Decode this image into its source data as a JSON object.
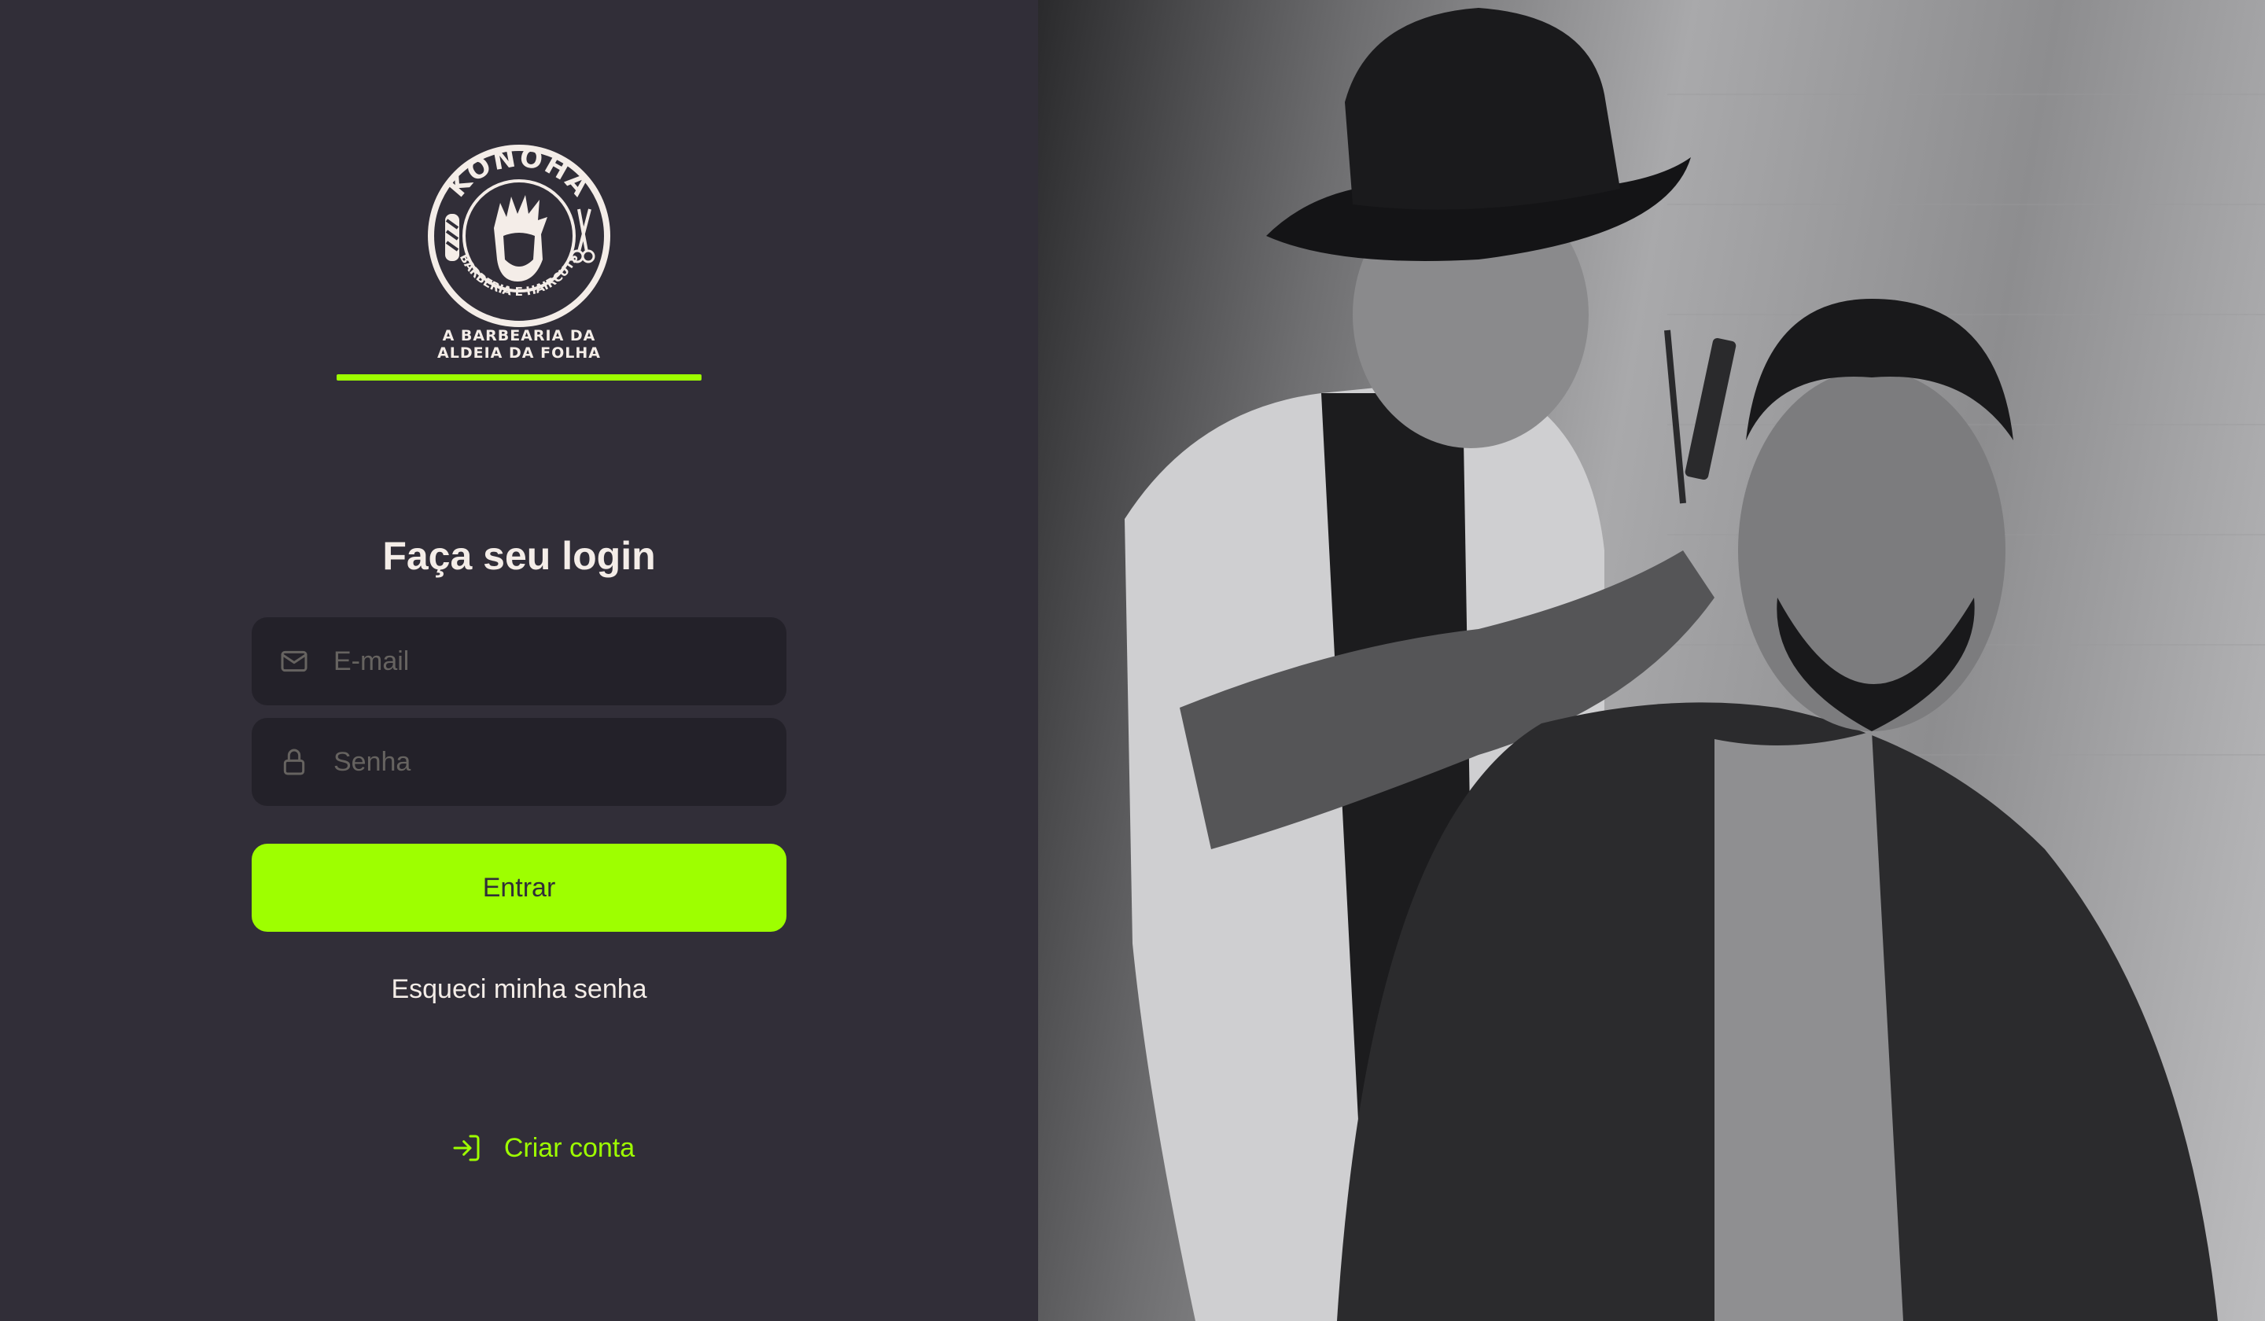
{
  "brand": {
    "logo_text_top": "KONOHA",
    "logo_text_ring": "BARBERIA E HAIRCUTS",
    "tagline_line1": "A BARBEARIA DA",
    "tagline_line2": "ALDEIA DA FOLHA",
    "accent_color": "#9eff00"
  },
  "login": {
    "title": "Faça seu login",
    "email_placeholder": "E-mail",
    "password_placeholder": "Senha",
    "submit_label": "Entrar",
    "forgot_label": "Esqueci minha senha",
    "create_account_label": "Criar conta"
  },
  "icons": {
    "email": "mail-icon",
    "password": "lock-icon",
    "create_account": "log-in-icon"
  },
  "colors": {
    "background": "#312e38",
    "input_background": "#232129",
    "text": "#f4ede8",
    "placeholder": "#666360"
  }
}
